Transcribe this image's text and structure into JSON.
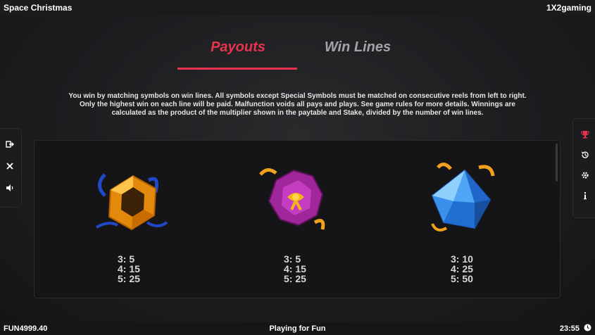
{
  "header": {
    "game_title": "Space Christmas",
    "brand": "1X2gaming"
  },
  "tabs": [
    {
      "label": "Payouts",
      "active": true
    },
    {
      "label": "Win Lines",
      "active": false
    }
  ],
  "intro_text": "You win by matching symbols on win lines. All symbols except Special Symbols must be matched on consecutive reels from left to right. Only the highest win on each line will be paid. Malfunction voids all pays and plays. See game rules for more details. Winnings are calculated as the product of the multiplier shown in the paytable and Stake, divided by the number of win lines.",
  "symbols": [
    {
      "icon": "orange-hexagon-gift-icon",
      "payouts": [
        "3: 5",
        "4: 15",
        "5: 25"
      ]
    },
    {
      "icon": "purple-ornament-gift-icon",
      "payouts": [
        "3: 5",
        "4: 15",
        "5: 25"
      ]
    },
    {
      "icon": "blue-crystal-gift-icon",
      "payouts": [
        "3: 10",
        "4: 25",
        "5: 50"
      ]
    }
  ],
  "left_controls": [
    "exit-icon",
    "close-icon",
    "sound-icon"
  ],
  "right_controls": [
    "trophy-icon",
    "history-icon",
    "settings-icon",
    "info-icon"
  ],
  "footer": {
    "balance": "FUN4999.40",
    "mode": "Playing for Fun",
    "time": "23:55"
  },
  "colors": {
    "accent": "#e8334f",
    "inactive_tab": "#a4a4a8",
    "background": "#1d1d20"
  }
}
